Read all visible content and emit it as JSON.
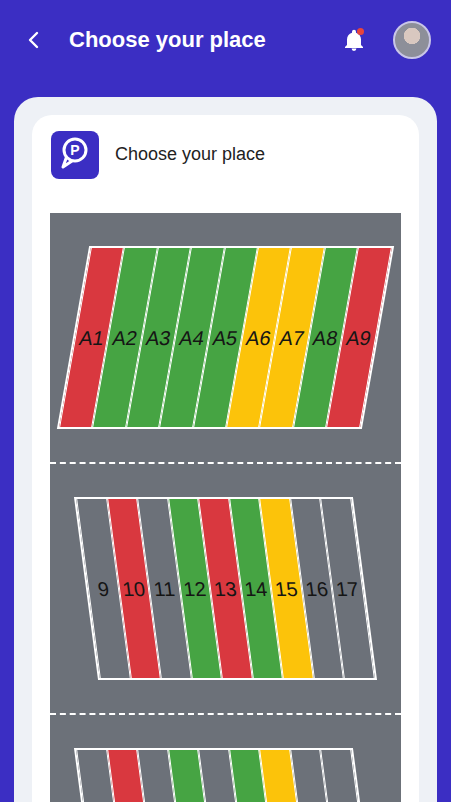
{
  "app_bar": {
    "title": "Choose your place",
    "notifications": {
      "unread": true
    }
  },
  "card": {
    "logo": "P",
    "title": "Choose your place"
  },
  "sections": [
    {
      "spots": [
        {
          "label": "A1",
          "color": "#d9383f"
        },
        {
          "label": "A2",
          "color": "#46a443"
        },
        {
          "label": "A3",
          "color": "#46a443"
        },
        {
          "label": "A4",
          "color": "#46a443"
        },
        {
          "label": "A5",
          "color": "#46a443"
        },
        {
          "label": "A6",
          "color": "#fcc30a"
        },
        {
          "label": "A7",
          "color": "#fcc30a"
        },
        {
          "label": "A8",
          "color": "#46a443"
        },
        {
          "label": "A9",
          "color": "#d9383f"
        }
      ]
    },
    {
      "spots": [
        {
          "label": "9",
          "color": "#6c7179"
        },
        {
          "label": "10",
          "color": "#d9383f"
        },
        {
          "label": "11",
          "color": "#6c7179"
        },
        {
          "label": "12",
          "color": "#46a443"
        },
        {
          "label": "13",
          "color": "#d9383f"
        },
        {
          "label": "14",
          "color": "#46a443"
        },
        {
          "label": "15",
          "color": "#fcc30a"
        },
        {
          "label": "16",
          "color": "#6c7179"
        },
        {
          "label": "17",
          "color": "#6c7179"
        }
      ]
    },
    {
      "spots": [
        {
          "color": "#6c7179"
        },
        {
          "color": "#d9383f"
        },
        {
          "color": "#6c7179"
        },
        {
          "color": "#46a443"
        },
        {
          "color": "#6c7179"
        },
        {
          "color": "#46a443"
        },
        {
          "color": "#fcc30a"
        },
        {
          "color": "#6c7179"
        },
        {
          "color": "#6c7179"
        }
      ]
    }
  ]
}
